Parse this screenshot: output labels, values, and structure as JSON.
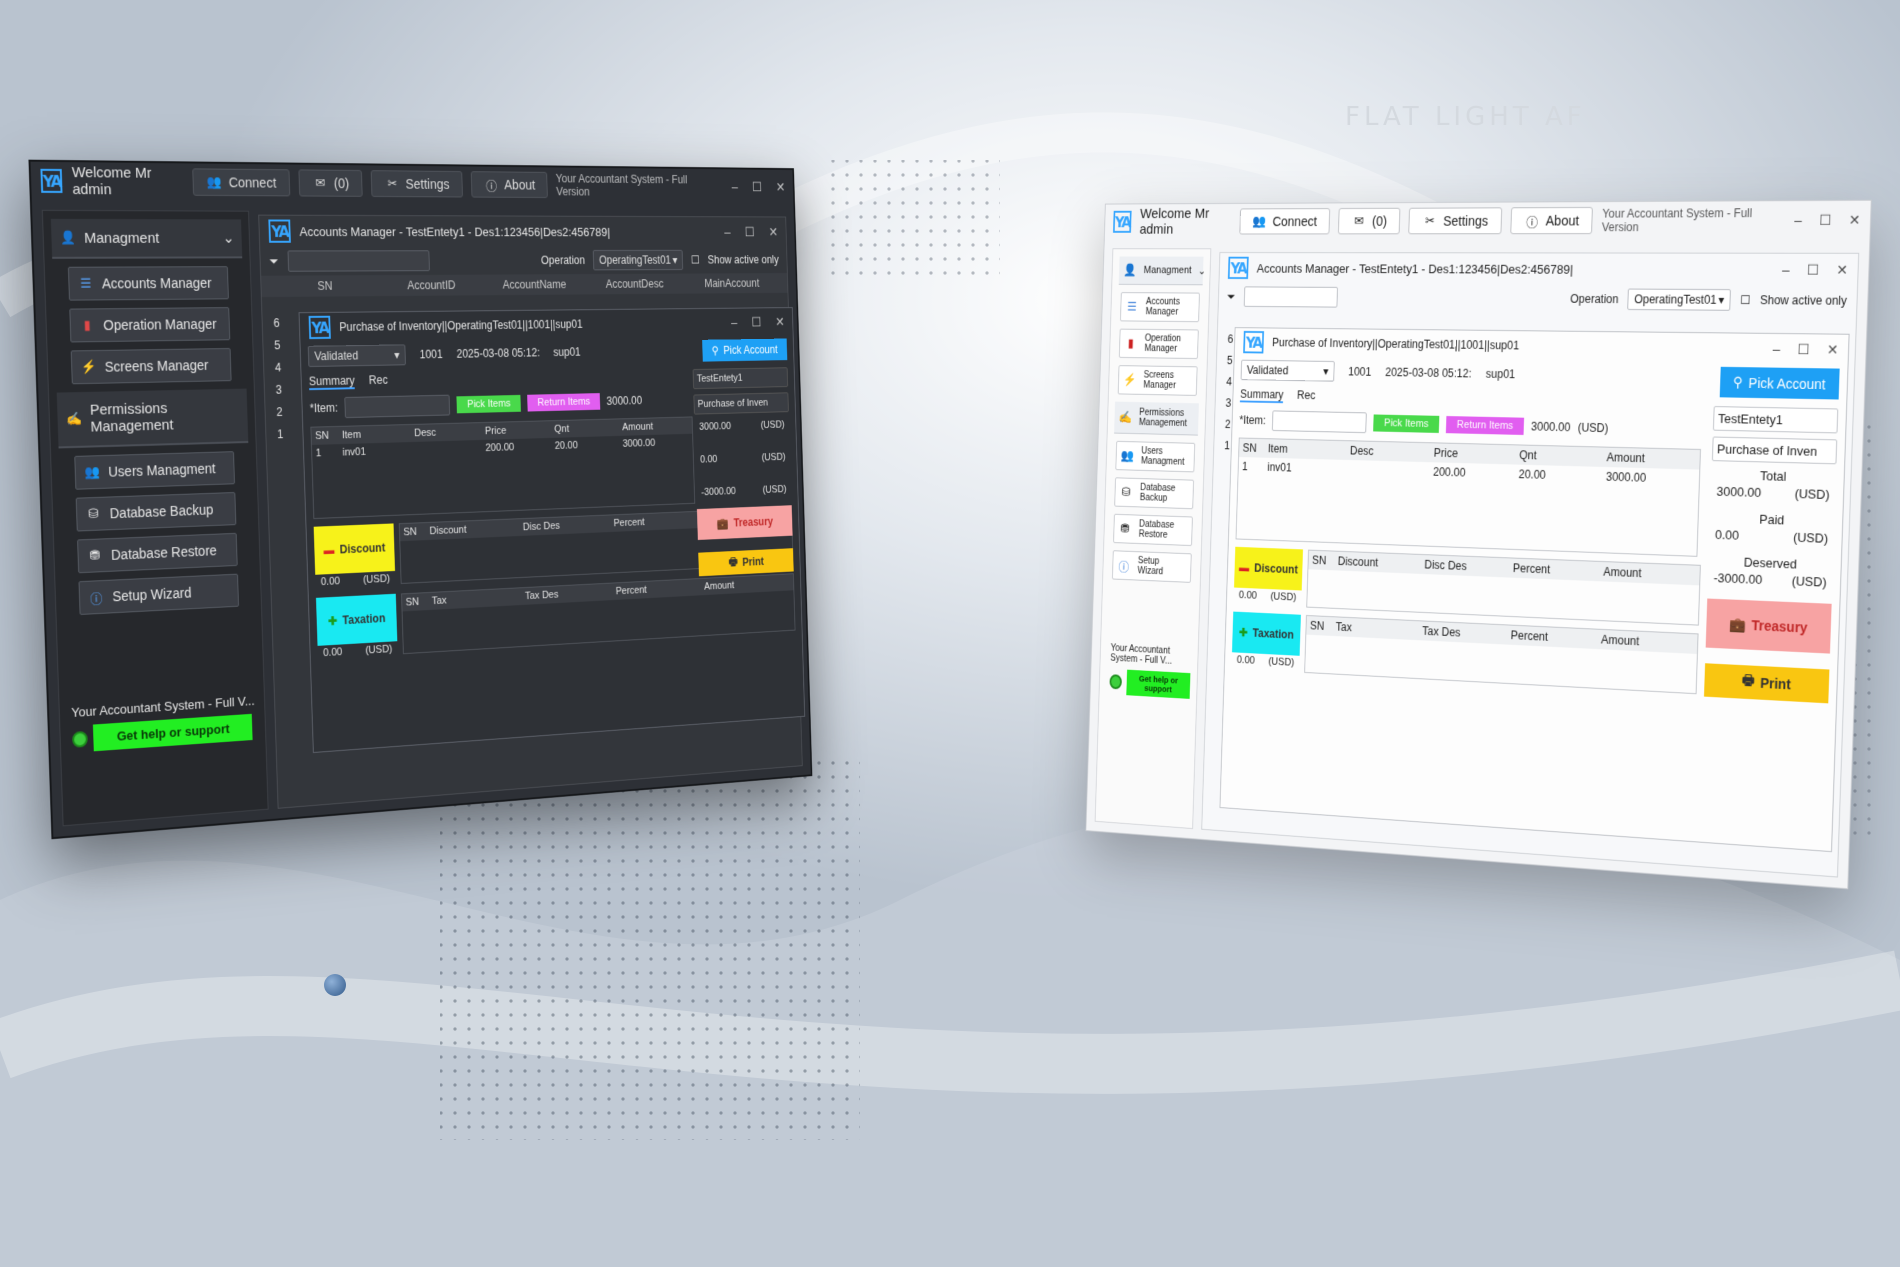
{
  "watermark": "FLAT LIGHT AF",
  "app": {
    "welcome": "Welcome Mr admin",
    "connect": "Connect",
    "messages": "(0)",
    "settings": "Settings",
    "about": "About",
    "window_title": "Your Accountant System - Full Version"
  },
  "sidebar": {
    "group_management": "Managment",
    "accounts_manager": "Accounts Manager",
    "operation_manager": "Operation Manager",
    "screens_manager": "Screens Manager",
    "group_permissions": "Permissions Management",
    "users_management": "Users Managment",
    "database_backup": "Database Backup",
    "database_restore": "Database Restore",
    "setup_wizard": "Setup Wizard",
    "brand": "Your Accountant System - Full V...",
    "help": "Get help or support"
  },
  "accounts": {
    "title": "Accounts Manager - TestEntety1 - Des1:123456|Des2:456789|",
    "operation_label": "Operation",
    "operation_value": "OperatingTest01",
    "show_active": "Show active only",
    "cols": [
      "SN",
      "AccountID",
      "AccountName",
      "AccountDesc",
      "MainAccount"
    ],
    "row_numbers": [
      "6",
      "5",
      "4",
      "3",
      "2",
      "1"
    ]
  },
  "purchase": {
    "title": "Purchase of Inventory||OperatingTest01||1001||sup01",
    "status": "Validated",
    "number": "1001",
    "datetime": "2025-03-08 05:12:",
    "supplier": "sup01",
    "pick_account": "Pick Account",
    "entity": "TestEntety1",
    "doc_type": "Purchase of Inven",
    "tab_summary": "Summary",
    "tab_rec": "Rec",
    "item_label": "*Item:",
    "pick_items": "Pick Items",
    "return_items": "Return Items",
    "items_total": "3000.00",
    "currency": "(USD)",
    "item_cols": [
      "SN",
      "Item",
      "Desc",
      "Price",
      "Qnt",
      "Amount"
    ],
    "item_row": {
      "sn": "1",
      "item": "inv01",
      "desc": "",
      "price": "200.00",
      "qnt": "20.00",
      "amount": "3000.00"
    },
    "total_label": "Total",
    "total_value": "3000.00",
    "paid_label": "Paid",
    "paid_value": "0.00",
    "deserved_label": "Deserved",
    "deserved_value": "-3000.00",
    "discount": "Discount",
    "discount_value": "0.00",
    "discount_cols": [
      "SN",
      "Discount",
      "Disc Des",
      "Percent",
      "Amount"
    ],
    "taxation": "Taxation",
    "tax_value": "0.00",
    "tax_cols": [
      "SN",
      "Tax",
      "Tax Des",
      "Percent",
      "Amount"
    ],
    "treasury": "Treasury",
    "print": "Print"
  }
}
